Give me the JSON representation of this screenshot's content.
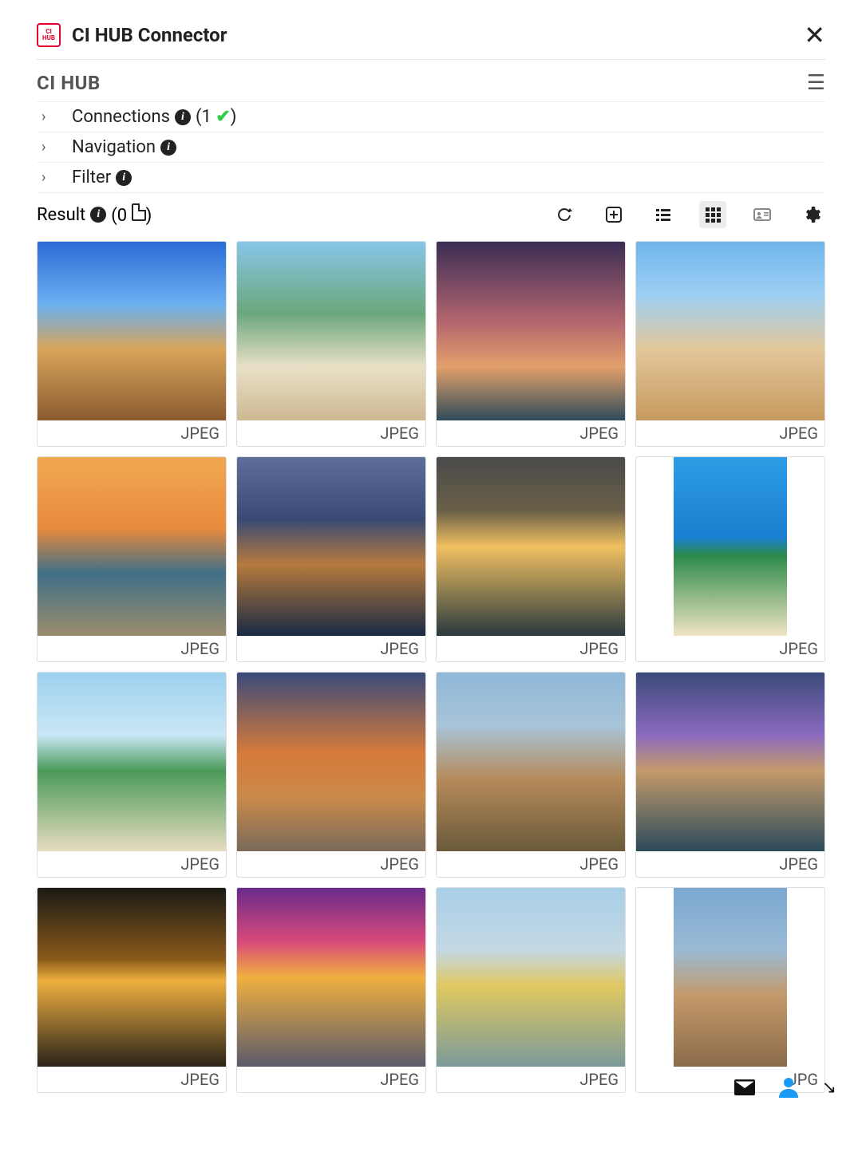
{
  "app": {
    "title": "CI HUB Connector",
    "logo_text": "CI\nHUB",
    "brand": "CI HUB"
  },
  "accordion": {
    "connections": {
      "label": "Connections",
      "count": "1"
    },
    "navigation": {
      "label": "Navigation"
    },
    "filter": {
      "label": "Filter"
    }
  },
  "result": {
    "label": "Result",
    "count": "0"
  },
  "items": [
    {
      "format": "JPEG",
      "orient": "landscape",
      "gradient": "linear-gradient(180deg,#2a6bd6 0%,#6ab0f0 35%,#d7a45a 60%,#8a5a2e 100%)"
    },
    {
      "format": "JPEG",
      "orient": "landscape",
      "gradient": "linear-gradient(180deg,#87c6e8 0%,#6ba77c 40%,#e9e0c6 70%,#cdb892 100%)"
    },
    {
      "format": "JPEG",
      "orient": "landscape",
      "gradient": "linear-gradient(180deg,#3a2d55 0%,#b4666e 45%,#e3a06a 70%,#2e4b5a 100%)"
    },
    {
      "format": "JPEG",
      "orient": "landscape",
      "gradient": "linear-gradient(180deg,#6fb6ec 0%,#9ecff3 30%,#e3c79a 60%,#c69a5f 100%)"
    },
    {
      "format": "JPEG",
      "orient": "landscape",
      "gradient": "linear-gradient(180deg,#f0a851 0%,#e88a3d 40%,#3f6f87 65%,#9c8d6d 100%)"
    },
    {
      "format": "JPEG",
      "orient": "landscape",
      "gradient": "linear-gradient(180deg,#5d6e9a 0%,#3a4a74 35%,#b57a3d 60%,#1a2a44 100%)"
    },
    {
      "format": "JPEG",
      "orient": "landscape",
      "gradient": "linear-gradient(180deg,#4a4a4a 0%,#6a6048 30%,#f0c060 50%,#2b3a3f 100%)"
    },
    {
      "format": "JPEG",
      "orient": "portrait",
      "gradient": "linear-gradient(180deg,#2f9de6 0%,#1a7fd0 45%,#2c8a4a 55%,#f0e4c4 100%)"
    },
    {
      "format": "JPEG",
      "orient": "landscape",
      "gradient": "linear-gradient(180deg,#9dd0ef 0%,#c9e7f5 35%,#4a9a5a 55%,#e7dcc0 100%)"
    },
    {
      "format": "JPEG",
      "orient": "landscape",
      "gradient": "linear-gradient(180deg,#3a4b7a 0%,#d67a3a 45%,#c98a4a 70%,#7a6a5a 100%)"
    },
    {
      "format": "JPEG",
      "orient": "landscape",
      "gradient": "linear-gradient(180deg,#8fb8d8 0%,#a8c4d8 30%,#b58a5a 60%,#6a5a3a 100%)"
    },
    {
      "format": "JPEG",
      "orient": "landscape",
      "gradient": "linear-gradient(180deg,#3a4a7a 0%,#8a6abf 35%,#c49a6a 55%,#2a4a5a 100%)"
    },
    {
      "format": "JPEG",
      "orient": "landscape",
      "gradient": "linear-gradient(180deg,#1a1a14 0%,#8a5a1a 40%,#f0b040 52%,#2a2418 100%)"
    },
    {
      "format": "JPEG",
      "orient": "landscape",
      "gradient": "linear-gradient(180deg,#6a2a8a 0%,#d84a7a 30%,#f0b040 50%,#5a5a6a 100%)"
    },
    {
      "format": "JPEG",
      "orient": "landscape",
      "gradient": "linear-gradient(180deg,#a8cfe8 0%,#c4d8e4 35%,#e0c860 55%,#7a9a9a 100%)"
    },
    {
      "format": "JPG",
      "orient": "portrait",
      "gradient": "linear-gradient(180deg,#7aa8d0 0%,#9abad4 35%,#c49a6a 60%,#8a6a4a 100%)"
    }
  ]
}
